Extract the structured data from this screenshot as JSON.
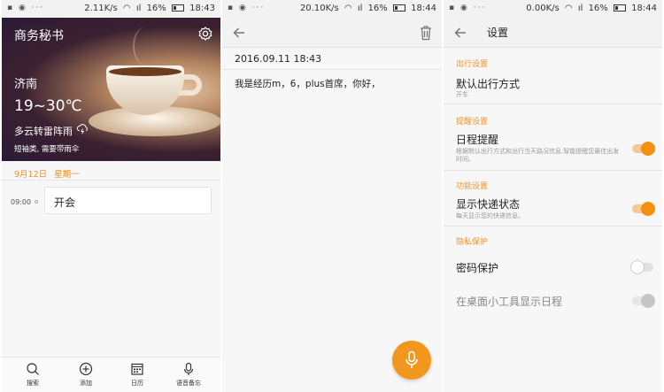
{
  "screens": [
    {
      "status": {
        "speed": "2.11K/s",
        "battery": "16%",
        "time": "18:43"
      },
      "app_title": "商务秘书",
      "weather": {
        "city": "济南",
        "temp": "19~30℃",
        "desc": "多云转雷阵雨",
        "tip": "短袖类, 需要带雨伞"
      },
      "date": {
        "day": "9月12日",
        "weekday": "星期一"
      },
      "event": {
        "time": "09:00",
        "title": "开会"
      },
      "tabs": [
        {
          "label": "搜索",
          "icon": "search-icon"
        },
        {
          "label": "添加",
          "icon": "add-icon"
        },
        {
          "label": "日历",
          "icon": "calendar-icon"
        },
        {
          "label": "语音备忘",
          "icon": "mic-icon"
        }
      ]
    },
    {
      "status": {
        "speed": "20.10K/s",
        "battery": "16%",
        "time": "18:44"
      },
      "note": {
        "datetime": "2016.09.11 18:43",
        "content": "我是经历m，6，plus首席，你好，"
      }
    },
    {
      "status": {
        "speed": "0.00K/s",
        "battery": "16%",
        "time": "18:44"
      },
      "title": "设置",
      "sections": {
        "travel": "出行设置",
        "reminder": "提醒设置",
        "feature": "功能设置",
        "privacy": "隐私保护"
      },
      "rows": {
        "travel_mode": {
          "title": "默认出行方式",
          "value": "开车"
        },
        "schedule_reminder": {
          "title": "日程提醒",
          "desc": "根据默认出行方式和出行当天路况信息,智能提醒您最佳出发时间。",
          "on": true
        },
        "express_status": {
          "title": "显示快递状态",
          "desc": "每天显示您的快递信息。",
          "on": true
        },
        "password": {
          "title": "密码保护",
          "on": false
        },
        "widget_schedule": {
          "title": "在桌面小工具显示日程",
          "on": true,
          "disabled": true
        }
      }
    }
  ],
  "colors": {
    "accent": "#f0932b",
    "fab": "#f2971d"
  }
}
